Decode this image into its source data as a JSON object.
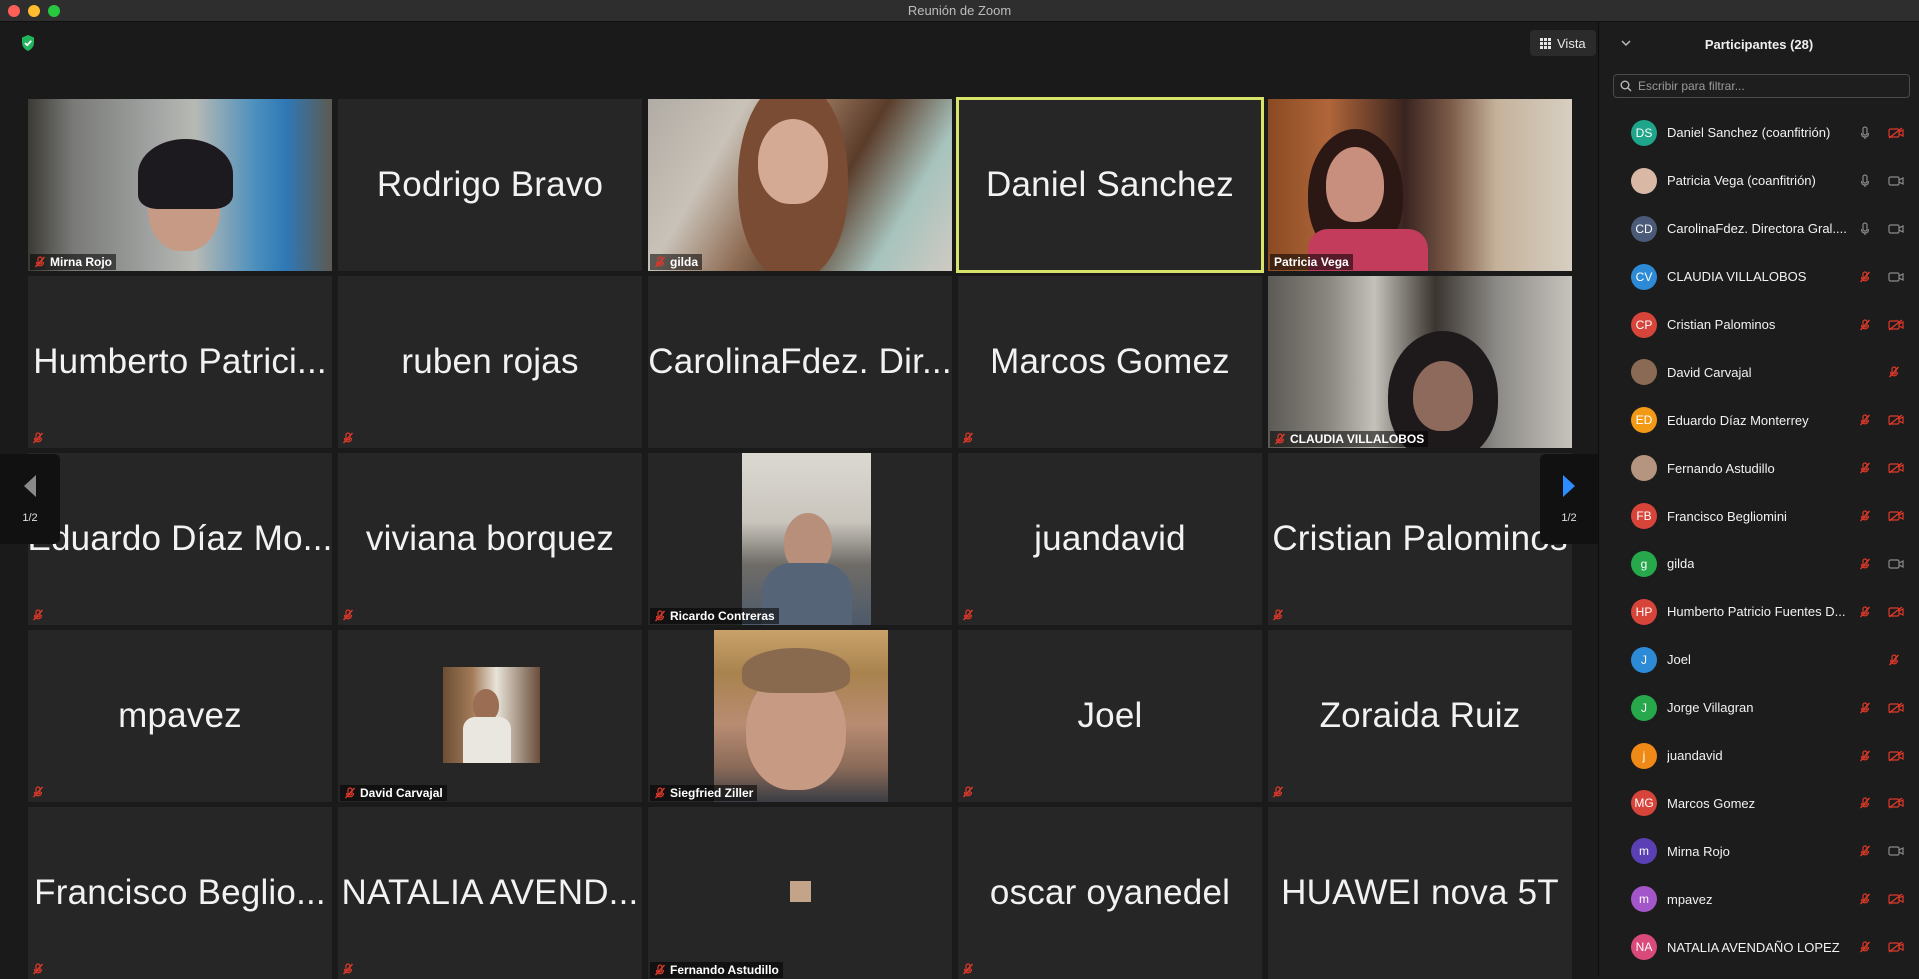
{
  "window": {
    "title": "Reunión de Zoom"
  },
  "toolbar": {
    "view_label": "Vista"
  },
  "pagination": {
    "left": "1/2",
    "right": "1/2"
  },
  "tiles": [
    {
      "name": "Mirna Rojo",
      "video": "mirna",
      "muted": true
    },
    {
      "name": "Rodrigo Bravo",
      "video": "",
      "muted": false
    },
    {
      "name": "gilda",
      "video": "gilda",
      "muted": true
    },
    {
      "name": "Daniel Sanchez",
      "video": "",
      "muted": false,
      "active": true
    },
    {
      "name": "Patricia Vega",
      "video": "patricia",
      "muted": false
    },
    {
      "name": "Humberto Patrici...",
      "video": "",
      "muted": true
    },
    {
      "name": "ruben rojas",
      "video": "",
      "muted": true
    },
    {
      "name": "CarolinaFdez. Dir...",
      "video": "",
      "muted": false
    },
    {
      "name": "Marcos Gomez",
      "video": "",
      "muted": true
    },
    {
      "name": "CLAUDIA VILLALOBOS",
      "video": "claudia",
      "muted": true
    },
    {
      "name": "Eduardo Díaz Mo...",
      "video": "",
      "muted": true
    },
    {
      "name": "viviana borquez",
      "video": "",
      "muted": true
    },
    {
      "name": "Ricardo Contreras",
      "video": "ricardo",
      "muted": true
    },
    {
      "name": "juandavid",
      "video": "",
      "muted": true
    },
    {
      "name": "Cristian Palominos",
      "video": "",
      "muted": true
    },
    {
      "name": "mpavez",
      "video": "",
      "muted": true
    },
    {
      "name": "David Carvajal",
      "video": "david",
      "muted": true
    },
    {
      "name": "Siegfried Ziller",
      "video": "siegfried",
      "muted": true
    },
    {
      "name": "Joel",
      "video": "",
      "muted": true
    },
    {
      "name": "Zoraida Ruiz",
      "video": "",
      "muted": true
    },
    {
      "name": "Francisco Beglio...",
      "video": "",
      "muted": true
    },
    {
      "name": "NATALIA AVEND...",
      "video": "",
      "muted": true
    },
    {
      "name": "Fernando Astudillo",
      "video": "fernando",
      "muted": true
    },
    {
      "name": "oscar oyanedel",
      "video": "",
      "muted": true
    },
    {
      "name": "HUAWEI nova 5T",
      "video": "",
      "muted": false
    }
  ],
  "participants_panel": {
    "title": "Participantes (28)",
    "search_placeholder": "Escribir para filtrar...",
    "items": [
      {
        "initials": "DS",
        "color": "#1fa58a",
        "name": "Daniel Sanchez (coanfitrión)",
        "mic": "on",
        "cam": "off"
      },
      {
        "initials": "",
        "color": "#d9b8a6",
        "name": "Patricia Vega (coanfitrión)",
        "mic": "on",
        "cam": "on"
      },
      {
        "initials": "CD",
        "color": "#4a5a78",
        "name": "CarolinaFdez. Directora Gral....",
        "mic": "on",
        "cam": "on"
      },
      {
        "initials": "CV",
        "color": "#2d8ad6",
        "name": "CLAUDIA VILLALOBOS",
        "mic": "off",
        "cam": "on"
      },
      {
        "initials": "CP",
        "color": "#d7443a",
        "name": "Cristian Palominos",
        "mic": "off",
        "cam": "off"
      },
      {
        "initials": "",
        "color": "#8a6a55",
        "name": "David Carvajal",
        "mic": "",
        "cam": "off-mic"
      },
      {
        "initials": "ED",
        "color": "#f29a16",
        "name": "Eduardo Díaz Monterrey",
        "mic": "off",
        "cam": "off"
      },
      {
        "initials": "",
        "color": "#b59480",
        "name": "Fernando Astudillo",
        "mic": "off",
        "cam": "off"
      },
      {
        "initials": "FB",
        "color": "#d7443a",
        "name": "Francisco Begliomini",
        "mic": "off",
        "cam": "off"
      },
      {
        "initials": "g",
        "color": "#27a84a",
        "name": "gilda",
        "mic": "off",
        "cam": "on"
      },
      {
        "initials": "HP",
        "color": "#d7443a",
        "name": "Humberto Patricio Fuentes D...",
        "mic": "off",
        "cam": "off"
      },
      {
        "initials": "J",
        "color": "#2d8ad6",
        "name": "Joel",
        "mic": "",
        "cam": "off-mic"
      },
      {
        "initials": "J",
        "color": "#27a84a",
        "name": "Jorge Villagran",
        "mic": "off",
        "cam": "off"
      },
      {
        "initials": "j",
        "color": "#f08a16",
        "name": "juandavid",
        "mic": "off",
        "cam": "off"
      },
      {
        "initials": "MG",
        "color": "#d7443a",
        "name": "Marcos Gomez",
        "mic": "off",
        "cam": "off"
      },
      {
        "initials": "m",
        "color": "#5a3fb5",
        "name": "Mirna Rojo",
        "mic": "off",
        "cam": "on"
      },
      {
        "initials": "m",
        "color": "#a356c9",
        "name": "mpavez",
        "mic": "off",
        "cam": "off"
      },
      {
        "initials": "NA",
        "color": "#d94a7a",
        "name": "NATALIA AVENDAÑO LOPEZ",
        "mic": "off",
        "cam": "off"
      }
    ]
  }
}
